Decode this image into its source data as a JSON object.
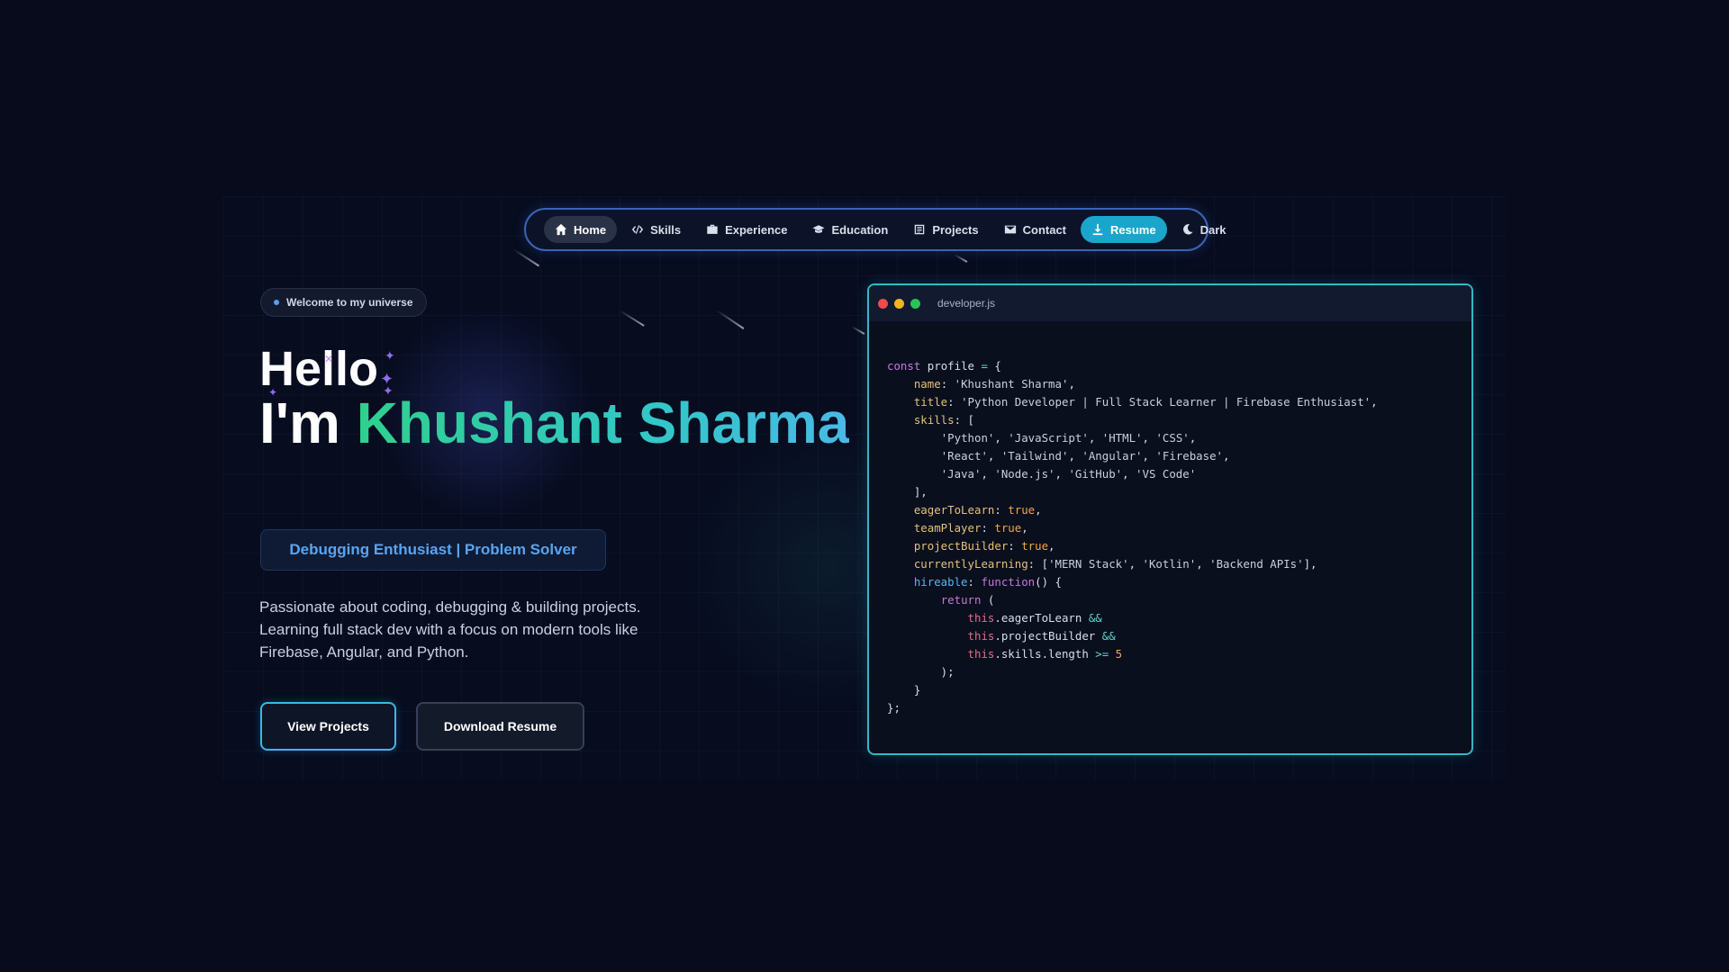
{
  "nav": {
    "items": [
      {
        "label": "Home",
        "icon": "home-icon",
        "state": "active"
      },
      {
        "label": "Skills",
        "icon": "code-icon"
      },
      {
        "label": "Experience",
        "icon": "briefcase-icon"
      },
      {
        "label": "Education",
        "icon": "graduation-cap-icon"
      },
      {
        "label": "Projects",
        "icon": "project-icon"
      },
      {
        "label": "Contact",
        "icon": "envelope-icon"
      },
      {
        "label": "Resume",
        "icon": "download-icon",
        "state": "highlight"
      },
      {
        "label": "Dark",
        "icon": "moon-icon"
      }
    ]
  },
  "hero": {
    "badge": "Welcome to my universe",
    "hello": "Hello",
    "intro": "I'm",
    "name": "Khushant Sharma",
    "tagline": "Debugging Enthusiast | Problem Solver",
    "description": "Passionate about coding, debugging & building projects. Learning full stack dev with a focus on modern tools like Firebase, Angular, and Python.",
    "primary_button": "View Projects",
    "secondary_button": "Download Resume"
  },
  "code_window": {
    "filename": "developer.js",
    "var_name": "profile",
    "name": "Khushant Sharma",
    "title": "Python Developer | Full Stack Learner | Firebase Enthusiast",
    "skills": [
      "Python",
      "JavaScript",
      "HTML",
      "CSS",
      "React",
      "Tailwind",
      "Angular",
      "Firebase",
      "Java",
      "Node.js",
      "GitHub",
      "VS Code"
    ],
    "eagerToLearn": "true",
    "teamPlayer": "true",
    "projectBuilder": "true",
    "currentlyLearning": [
      "MERN Stack",
      "Kotlin",
      "Backend APIs"
    ],
    "skills_threshold": "5"
  },
  "colors": {
    "background": "#070b1c",
    "accent_cyan": "#1aa6cc",
    "name_gradient_start": "#2fd08e",
    "name_gradient_end": "#49b9e6",
    "tagline_text": "#5aa4f0"
  }
}
